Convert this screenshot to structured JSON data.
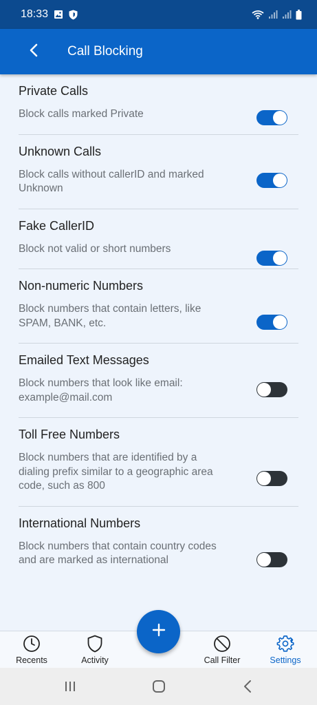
{
  "status_bar": {
    "time": "18:33",
    "icons_left": [
      "gallery-icon",
      "shield-icon"
    ],
    "icons_right": [
      "wifi-icon",
      "signal-icon",
      "signal-icon",
      "battery-icon"
    ]
  },
  "app_bar": {
    "title": "Call Blocking",
    "back_icon": "chevron-left-icon"
  },
  "colors": {
    "accent": "#0b65c8",
    "status_bar": "#0c4a8f",
    "background": "#eef4fc",
    "toggle_off": "#2d3338"
  },
  "settings": [
    {
      "title": "Private Calls",
      "description": "Block calls marked Private",
      "enabled": true
    },
    {
      "title": "Unknown Calls",
      "description": "Block calls without callerID and marked Unknown",
      "enabled": true
    },
    {
      "title": "Fake CallerID",
      "description": "Block not valid or short numbers",
      "enabled": true
    },
    {
      "title": "Non-numeric Numbers",
      "description": "Block numbers that contain letters, like SPAM, BANK, etc.",
      "enabled": true
    },
    {
      "title": "Emailed Text Messages",
      "description": "Block numbers that look like email: example@mail.com",
      "enabled": false
    },
    {
      "title": "Toll Free Numbers",
      "description": "Block numbers that are identified by a dialing prefix similar to a geographic area code, such as 800",
      "enabled": false
    },
    {
      "title": "International Numbers",
      "description": "Block numbers that contain country codes and are marked as international",
      "enabled": false
    }
  ],
  "bottom_nav": {
    "items": [
      {
        "label": "Recents",
        "icon": "clock-icon",
        "active": false
      },
      {
        "label": "Activity",
        "icon": "shield-icon",
        "active": false
      },
      {
        "label": "Call Filter",
        "icon": "block-icon",
        "active": false
      },
      {
        "label": "Settings",
        "icon": "gear-icon",
        "active": true
      }
    ],
    "fab_icon": "plus-icon"
  },
  "system_nav": {
    "icons": [
      "recent-apps-icon",
      "home-icon",
      "back-icon"
    ]
  }
}
